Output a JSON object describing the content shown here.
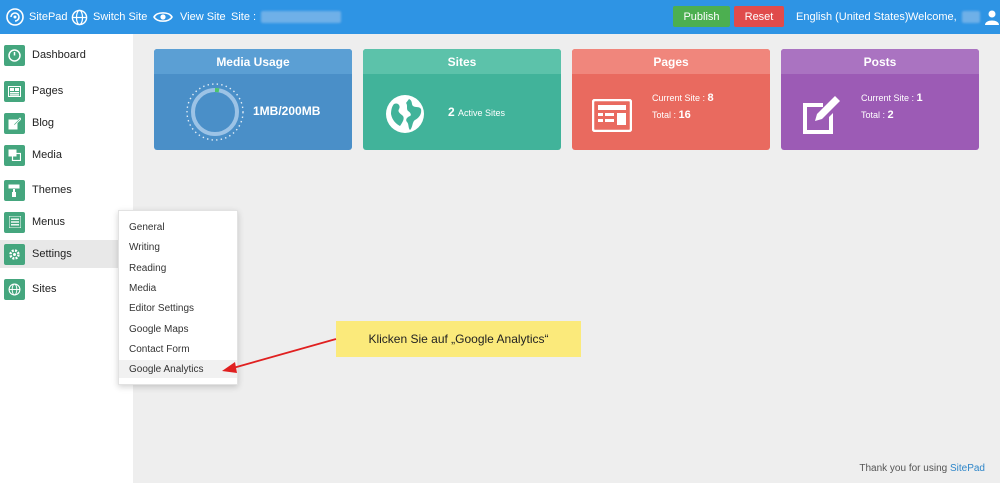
{
  "topbar": {
    "brand": "SitePad",
    "switch_site": "Switch Site",
    "view_site": "View Site",
    "site_label": "Site :",
    "publish": "Publish",
    "reset": "Reset",
    "language": "English (United States)",
    "welcome": "Welcome,"
  },
  "sidebar": {
    "items": [
      {
        "label": "Dashboard",
        "icon": "dashboard-icon"
      },
      {
        "label": "Pages",
        "icon": "pages-icon"
      },
      {
        "label": "Blog",
        "icon": "blog-icon"
      },
      {
        "label": "Media",
        "icon": "media-icon"
      },
      {
        "label": "Themes",
        "icon": "themes-icon"
      },
      {
        "label": "Menus",
        "icon": "menus-icon"
      },
      {
        "label": "Settings",
        "icon": "gear-icon"
      },
      {
        "label": "Sites",
        "icon": "globe-icon"
      }
    ]
  },
  "cards": {
    "media": {
      "title": "Media Usage",
      "value": "1MB/200MB"
    },
    "sites": {
      "title": "Sites",
      "count": "2",
      "suffix": "Active Sites"
    },
    "pages": {
      "title": "Pages",
      "current_label": "Current Site :",
      "current": "8",
      "total_label": "Total :",
      "total": "16"
    },
    "posts": {
      "title": "Posts",
      "current_label": "Current Site :",
      "current": "1",
      "total_label": "Total :",
      "total": "2"
    }
  },
  "settings_menu": {
    "items": [
      "General",
      "Writing",
      "Reading",
      "Media",
      "Editor Settings",
      "Google Maps",
      "Contact Form",
      "Google Analytics"
    ],
    "highlighted": "Google Analytics"
  },
  "callout": {
    "text": "Klicken Sie auf „Google Analytics“"
  },
  "footer": {
    "text": "Thank you for using",
    "brand": "SitePad"
  },
  "colors": {
    "topbar": "#2e94e4",
    "accent_green": "#45a67e",
    "publish": "#4caf50",
    "reset": "#e04b4b",
    "callout": "#fbea7b",
    "arrow": "#e02020"
  }
}
